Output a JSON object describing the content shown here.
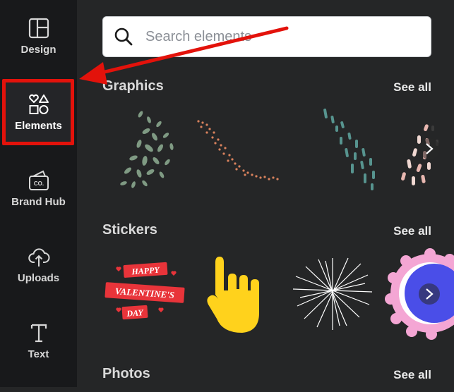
{
  "sidebar": {
    "items": [
      {
        "label": "Design",
        "icon": "layout-icon"
      },
      {
        "label": "Elements",
        "icon": "shapes-icon",
        "active": true
      },
      {
        "label": "Brand Hub",
        "icon": "brand-hub-icon"
      },
      {
        "label": "Uploads",
        "icon": "cloud-upload-icon"
      },
      {
        "label": "Text",
        "icon": "text-icon"
      }
    ]
  },
  "search": {
    "placeholder": "Search elements"
  },
  "sections": {
    "graphics": {
      "title": "Graphics",
      "see_all": "See all"
    },
    "stickers": {
      "title": "Stickers",
      "see_all": "See all"
    },
    "photos": {
      "title": "Photos",
      "see_all": "See all"
    }
  },
  "stickers": {
    "valentine": {
      "line1": "HAPPY",
      "line2": "VALENTINE'S",
      "line3": "DAY"
    },
    "hand_color": "#ffd21c"
  },
  "brand_hub_badge": "CO.",
  "colors": {
    "sidebar_bg": "#18191b",
    "main_bg": "#252627",
    "annotation_red": "#e3120b"
  }
}
